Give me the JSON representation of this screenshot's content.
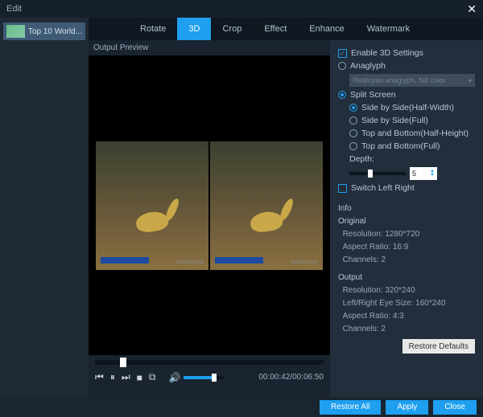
{
  "titlebar": {
    "title": "Edit"
  },
  "sidebar": {
    "items": [
      {
        "label": "Top 10 World..."
      }
    ]
  },
  "tabs": [
    {
      "label": "Rotate"
    },
    {
      "label": "3D",
      "active": true
    },
    {
      "label": "Crop"
    },
    {
      "label": "Effect"
    },
    {
      "label": "Enhance"
    },
    {
      "label": "Watermark"
    }
  ],
  "preview": {
    "label": "Output Preview",
    "watermark": "watchmojo",
    "time": "00:00:42/00:06:50",
    "seek_pct": 11,
    "volume_pct": 70
  },
  "settings": {
    "enable_label": "Enable 3D Settings",
    "enable_checked": true,
    "anaglyph_label": "Anaglyph",
    "anaglyph_selected": false,
    "anaglyph_option": "Red/cyan anaglyph, full color",
    "split_label": "Split Screen",
    "split_selected": true,
    "modes": [
      {
        "label": "Side by Side(Half-Width)",
        "selected": true
      },
      {
        "label": "Side by Side(Full)",
        "selected": false
      },
      {
        "label": "Top and Bottom(Half-Height)",
        "selected": false
      },
      {
        "label": "Top and Bottom(Full)",
        "selected": false
      }
    ],
    "depth_label": "Depth:",
    "depth_value": "5",
    "depth_pct": 33,
    "switch_label": "Switch Left Right",
    "switch_checked": false
  },
  "info": {
    "header": "Info",
    "original": {
      "title": "Original",
      "resolution_label": "Resolution:",
      "resolution": "1280*720",
      "aspect_label": "Aspect Ratio:",
      "aspect": "16:9",
      "channels_label": "Channels:",
      "channels": "2"
    },
    "output": {
      "title": "Output",
      "resolution_label": "Resolution:",
      "resolution": "320*240",
      "eyesize_label": "Left/Right Eye Size:",
      "eyesize": "160*240",
      "aspect_label": "Aspect Ratio:",
      "aspect": "4:3",
      "channels_label": "Channels:",
      "channels": "2"
    }
  },
  "buttons": {
    "restore_defaults": "Restore Defaults",
    "restore_all": "Restore All",
    "apply": "Apply",
    "close": "Close"
  }
}
